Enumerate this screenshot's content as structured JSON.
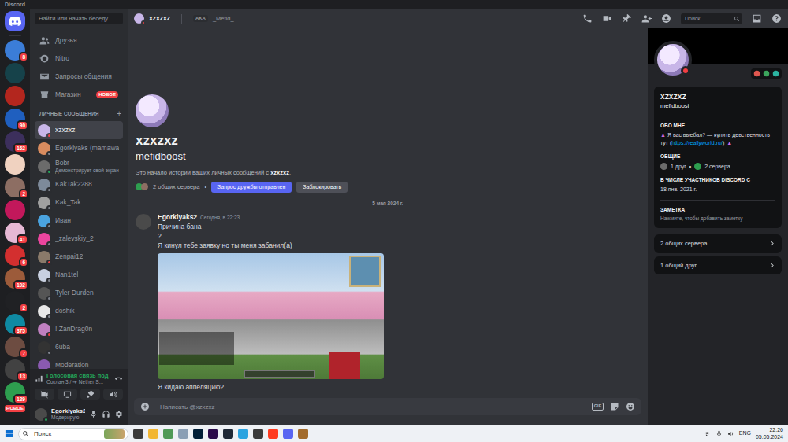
{
  "app": {
    "title": "Discord",
    "new_label": "НОВОЕ"
  },
  "servers": [
    {
      "badge": "8",
      "color": "#3b7dd8"
    },
    {
      "badge": "",
      "color": "#16424a"
    },
    {
      "badge": "",
      "color": "#b3261e"
    },
    {
      "badge": "90",
      "color": "#1f5fbf"
    },
    {
      "badge": "162",
      "color": "#3c2f5c"
    },
    {
      "badge": "",
      "color": "#f0d2c0"
    },
    {
      "badge": "2",
      "color": "#8d6e63"
    },
    {
      "badge": "",
      "color": "#c2185b"
    },
    {
      "badge": "41",
      "color": "#e6b8d4"
    },
    {
      "badge": "6",
      "color": "#d32f2f"
    },
    {
      "badge": "102",
      "color": "#9c5b3a"
    },
    {
      "badge": "2",
      "color": "#202124"
    },
    {
      "badge": "375",
      "color": "#0f8aa3"
    },
    {
      "badge": "7",
      "color": "#6d4c41"
    },
    {
      "badge": "13",
      "color": "#424242"
    },
    {
      "badge": "129",
      "color": "#2e9e4f"
    }
  ],
  "sidebar": {
    "search": {
      "placeholder": "Найти или начать беседу"
    },
    "nav": [
      {
        "label": "Друзья",
        "badge": ""
      },
      {
        "label": "Nitro",
        "badge": ""
      },
      {
        "label": "Запросы общения",
        "badge": ""
      },
      {
        "label": "Магазин",
        "badge": "НОВОЕ"
      }
    ],
    "dm_title": "ЛИЧНЫЕ СООБЩЕНИЯ",
    "dm_add": "+",
    "dms": [
      {
        "name": "xzxzxz",
        "subtitle": "",
        "selected": true,
        "status": "dnd",
        "color": "#c8b6e8"
      },
      {
        "name": "Egorklyaks (mamawa",
        "subtitle": "",
        "selected": false,
        "status": "offline",
        "color": "#d98c5f"
      },
      {
        "name": "Bobr",
        "subtitle": "Демонстрирует свой экран",
        "selected": false,
        "status": "online",
        "color": "#6b6b6b"
      },
      {
        "name": "KakTak2288",
        "subtitle": "",
        "selected": false,
        "status": "offline",
        "color": "#7d8a9a"
      },
      {
        "name": "Kak_Tak",
        "subtitle": "",
        "selected": false,
        "status": "offline",
        "color": "#a0a0a0"
      },
      {
        "name": "Иван",
        "subtitle": "",
        "selected": false,
        "status": "offline",
        "color": "#4aa3df"
      },
      {
        "name": "_zalevskiy_2",
        "subtitle": "",
        "selected": false,
        "status": "offline",
        "color": "#eb459e"
      },
      {
        "name": "Zenpai12",
        "subtitle": "",
        "selected": false,
        "status": "dnd",
        "color": "#8a7a6a"
      },
      {
        "name": "Nan1tel",
        "subtitle": "",
        "selected": false,
        "status": "offline",
        "color": "#c8d0e0"
      },
      {
        "name": "Tyler Durden",
        "subtitle": "",
        "selected": false,
        "status": "offline",
        "color": "#555555"
      },
      {
        "name": "doshik",
        "subtitle": "",
        "selected": false,
        "status": "offline",
        "color": "#e8e8e8"
      },
      {
        "name": "! ZariDrag0n",
        "subtitle": "",
        "selected": false,
        "status": "dnd",
        "color": "#c080c0"
      },
      {
        "name": "6uba",
        "subtitle": "",
        "selected": false,
        "status": "offline",
        "color": "#333333"
      },
      {
        "name": "Moderation",
        "subtitle": "",
        "selected": false,
        "status": "offline",
        "color": "#8a5ab0"
      }
    ]
  },
  "voice": {
    "title": "Голосовая связь под",
    "channel": "Соклан 3 / ➜ Nether S..."
  },
  "user": {
    "name": "Egorklyaks2",
    "status": "Модерирую"
  },
  "header": {
    "name": "xzxzxz",
    "status": "dnd",
    "aka": "AKA",
    "aka_name": "_Mefid_",
    "search": {
      "placeholder": "Поиск"
    }
  },
  "intro": {
    "name": "xzxzxz",
    "username": "mefidboost",
    "text": "Это начало истории ваших личных сообщений с ",
    "text_name": "xzxzxz",
    "text_end": ".",
    "mutual": "2 общих сервера",
    "sep": "•",
    "friend_button": "Запрос дружбы отправлен",
    "block_button": "Заблокировать"
  },
  "date_divider": "5 мая 2024 г.",
  "messages": [
    {
      "author": "Egorklyaks2",
      "time": "Сегодня, в 22:23",
      "parts": [
        {
          "kind": "text",
          "text": "Причина бана"
        },
        {
          "kind": "text",
          "text": "?"
        },
        {
          "kind": "text",
          "text": "Я кинул тебе заявку но ты меня забанил(а)"
        },
        {
          "kind": "image"
        },
        {
          "kind": "text",
          "text": "Я кидаю аппеляцию?"
        }
      ]
    }
  ],
  "composer": {
    "placeholder": "Написать @xzxzxz",
    "gif": "GIF"
  },
  "profile": {
    "display_name": "XZXZXZ",
    "username": "mefidboost",
    "status": "dnd",
    "about_title": "ОБО МНЕ",
    "bio_icon": "▲",
    "bio_text": " Я вас выебал? — купить девственность тут (",
    "bio_link": "https://reallyworld.ru/",
    "bio_close": ")",
    "bio_icon_end": "▲",
    "common_title": "ОБЩИЕ",
    "friends": "1 друг",
    "sep": "•",
    "servers": "2 сервера",
    "member_title": "В ЧИСЛЕ УЧАСТНИКОВ DISCORD С",
    "member_since": "18 янв. 2021 г.",
    "note_title": "ЗАМЕТКА",
    "note_placeholder": "Нажмите, чтобы добавить заметку",
    "rows": [
      {
        "label": "2 общих сервера"
      },
      {
        "label": "1 общий друг"
      }
    ]
  },
  "taskbar": {
    "search": {
      "placeholder": "Поиск"
    },
    "lang": "ENG",
    "time": "22:26",
    "date": "05.05.2024"
  }
}
